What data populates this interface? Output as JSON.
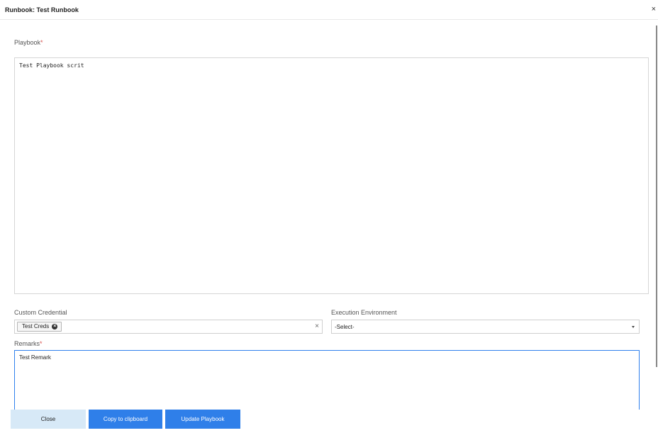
{
  "modal": {
    "title": "Runbook: Test Runbook",
    "close_glyph": "×"
  },
  "playbook": {
    "label": "Playbook",
    "required_mark": "*",
    "value": "Test Playbook scrit"
  },
  "custom_credential": {
    "label": "Custom Credential",
    "chips": [
      {
        "label": "Test Creds",
        "remove_icon": "circle-x-icon"
      }
    ],
    "clear_glyph": "×"
  },
  "execution_environment": {
    "label": "Execution Environment",
    "selected": "-Select-"
  },
  "remarks": {
    "label": "Remarks",
    "required_mark": "*",
    "value": "Test Remark"
  },
  "footer": {
    "close_label": "Close",
    "copy_label": "Copy to clipboard",
    "update_label": "Update Playbook"
  },
  "colors": {
    "primary": "#2f7fe9",
    "secondary": "#d7e9f7",
    "required": "#d9534f",
    "focus_border": "#2f80ed"
  }
}
